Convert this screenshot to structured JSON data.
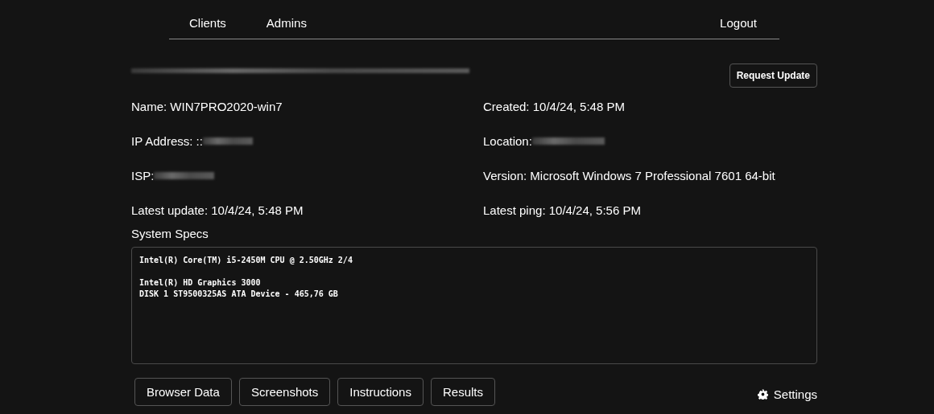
{
  "nav": {
    "links": [
      {
        "label": "Clients"
      },
      {
        "label": "Admins"
      }
    ],
    "logout": "Logout"
  },
  "client_id": {
    "blurred": true
  },
  "request_button": "Request Update",
  "fields": [
    {
      "label": "Name: WIN7PRO2020-win7",
      "blurred": false
    },
    {
      "label": "Created: 10/4/24, 5:48 PM",
      "blurred": false
    },
    {
      "label": "IP Address: ::",
      "blurred": true
    },
    {
      "label": "Location:",
      "blurred": true
    },
    {
      "label": "ISP:",
      "blurred": true
    },
    {
      "label": "Version: Microsoft Windows 7 Professional 7601 64-bit",
      "blurred": false
    },
    {
      "label": "Latest update: 10/4/24, 5:48 PM",
      "blurred": false
    },
    {
      "label": "Latest ping: 10/4/24, 5:56 PM",
      "blurred": false
    }
  ],
  "specs": {
    "title": "System Specs",
    "text": "Intel(R) Core(TM) i5-2450M CPU @ 2.50GHz 2/4\n\nIntel(R) HD Graphics 3000\nDISK 1 ST9500325AS ATA Device - 465,76 GB"
  },
  "buttons": [
    "Browser Data",
    "Screenshots",
    "Instructions",
    "Results"
  ],
  "settings": "Settings"
}
